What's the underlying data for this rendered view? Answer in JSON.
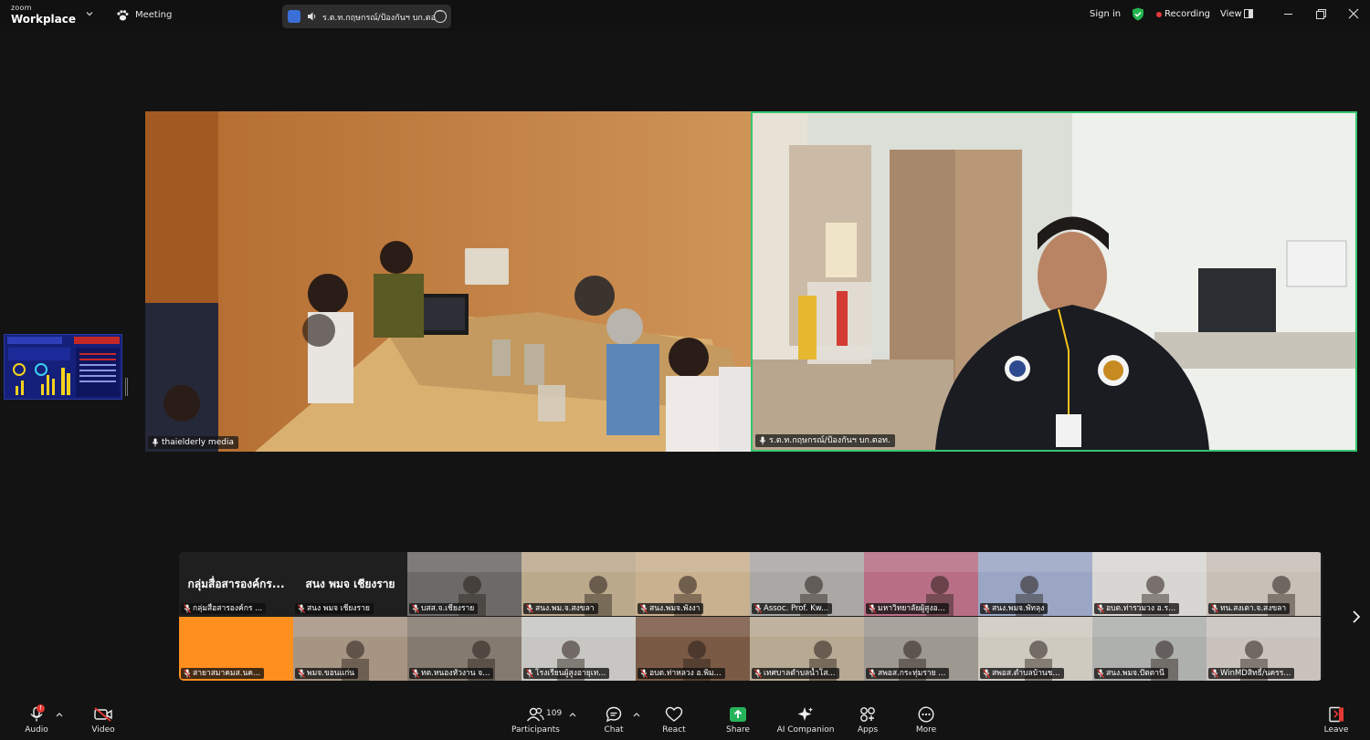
{
  "titlebar": {
    "brand_small": "zoom",
    "brand_big": "Workplace",
    "meeting_label": "Meeting",
    "speaker_name": "ร.ต.ท.กฤษกรณ์/ป้องกันฯ บก.ตอ",
    "sign_in": "Sign in",
    "recording": "Recording",
    "view": "View"
  },
  "main_videos": [
    {
      "name": "thaielderly media"
    },
    {
      "name": "ร.ต.ท.กฤษกรณ์/ป้องกันฯ บก.ตอท."
    }
  ],
  "gallery": {
    "tiles": [
      {
        "name": "กลุ่มสื่อสารองค์กร ...",
        "big_text": "กลุ่มสื่อสารองค์กร...",
        "bg": "#1f1f1f"
      },
      {
        "name": "สนง พมจ เชียงราย",
        "big_text": "สนง พมจ เชียงราย",
        "bg": "#1f1f1f"
      },
      {
        "name": "บสส.จ.เชียงราย",
        "bg": "#6b6a68"
      },
      {
        "name": "สนง.พม.จ.สงขลา",
        "bg": "#bba98c"
      },
      {
        "name": "สนง.พมจ.พังงา",
        "bg": "#c9b08f"
      },
      {
        "name": "Assoc. Prof. Kw...",
        "bg": "#a9a8a4"
      },
      {
        "name": "มหาวิทยาลัยผู้สูงอ...",
        "bg": "#b86f86"
      },
      {
        "name": "สนง.พมจ.พัทลุง",
        "bg": "#9aa6c4"
      },
      {
        "name": "อบต.ท่ารวมวง อ.ร...",
        "bg": "#d8d6d2"
      },
      {
        "name": "ทน.สงเตา.จ.สงขลา",
        "bg": "#c8bfb7"
      },
      {
        "name": "สายาสมาคมส.นค...",
        "bg": "#ff8f1f"
      },
      {
        "name": "พมจ.ขอนแก่น",
        "bg": "#a79584"
      },
      {
        "name": "ทต.หนองหัวงาน จ...",
        "bg": "#857a70"
      },
      {
        "name": "โรงเรียนผู้สูงอายุเท...",
        "bg": "#c7c6c2"
      },
      {
        "name": "อบต.ท่าหลวง อ.พิม...",
        "bg": "#7b5a45"
      },
      {
        "name": "เทศบาลตำบลน้ำโส...",
        "bg": "#b7a992"
      },
      {
        "name": "สพอส.กระทุ่มราย ...",
        "bg": "#9d9890"
      },
      {
        "name": "สพอส.ตำบลบ้านช...",
        "bg": "#cfcac0"
      },
      {
        "name": "สนง.พมจ.ปัตตานี",
        "bg": "#aeb0ad"
      },
      {
        "name": "WinMDสิทธิ์/นครร...",
        "bg": "#c9c2bd"
      }
    ]
  },
  "toolbar": {
    "audio": "Audio",
    "audio_badge": "!",
    "video": "Video",
    "participants": "Participants",
    "participant_count": "109",
    "chat": "Chat",
    "react": "React",
    "share": "Share",
    "ai_companion": "AI Companion",
    "apps": "Apps",
    "more": "More",
    "leave": "Leave"
  },
  "colors": {
    "active_speaker_border": "#36c46f",
    "share_green": "#26b35a",
    "recording_red": "#e53935"
  }
}
